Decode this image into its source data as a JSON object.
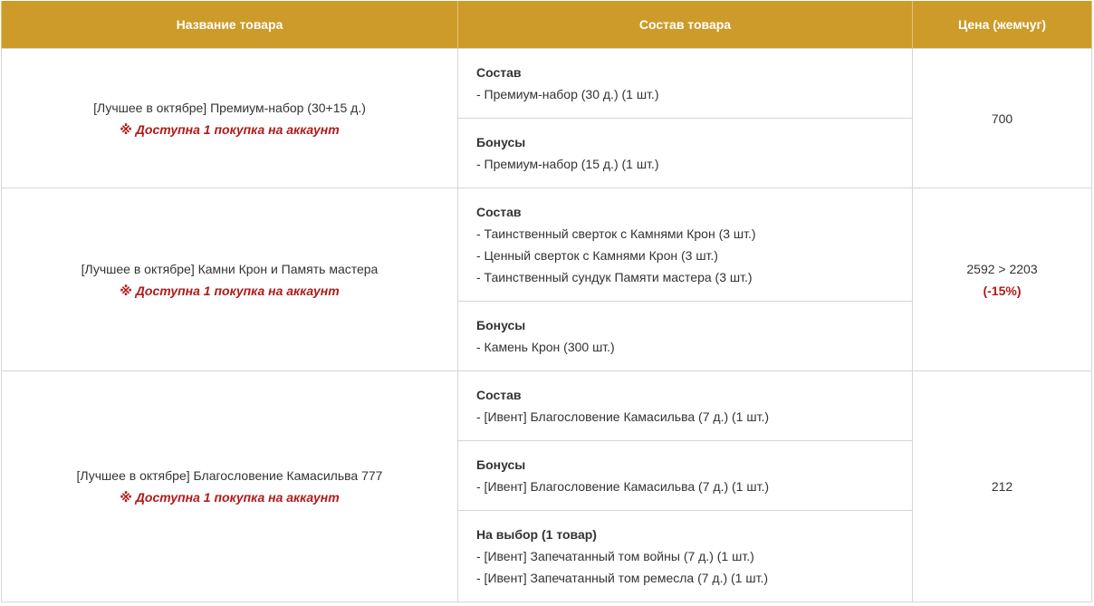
{
  "table": {
    "headers": {
      "name": "Название товара",
      "content": "Состав товара",
      "price": "Цена (жемчуг)"
    },
    "rows": [
      {
        "name": "[Лучшее в октябре] Премиум-набор (30+15 д.)",
        "limit": "※ Доступна 1 покупка на аккаунт",
        "price": "700",
        "discount": "",
        "sections": [
          {
            "title": "Состав",
            "items": [
              "- Премиум-набор (30 д.) (1 шт.)"
            ]
          },
          {
            "title": "Бонусы",
            "items": [
              "- Премиум-набор (15 д.) (1 шт.)"
            ]
          }
        ]
      },
      {
        "name": "[Лучшее в октябре] Камни Крон и Память мастера",
        "limit": "※ Доступна 1 покупка на аккаунт",
        "price": "2592 > 2203",
        "discount": "(-15%)",
        "sections": [
          {
            "title": "Состав",
            "items": [
              "- Таинственный сверток с Камнями Крон (3 шт.)",
              "- Ценный сверток с Камнями Крон (3 шт.)",
              "- Таинственный сундук Памяти мастера (3 шт.)"
            ]
          },
          {
            "title": "Бонусы",
            "items": [
              "- Камень Крон (300 шт.)"
            ]
          }
        ]
      },
      {
        "name": "[Лучшее в октябре] Благословение Камасильва 777",
        "limit": "※ Доступна 1 покупка на аккаунт",
        "price": "212",
        "discount": "",
        "sections": [
          {
            "title": "Состав",
            "items": [
              "- [Ивент] Благословение Камасильва (7 д.) (1 шт.)"
            ]
          },
          {
            "title": "Бонусы",
            "items": [
              "- [Ивент] Благословение Камасильва (7 д.) (1 шт.)"
            ]
          },
          {
            "title": "На выбор (1 товар)",
            "items": [
              "- [Ивент] Запечатанный том войны (7 д.) (1 шт.)",
              "- [Ивент] Запечатанный том ремесла (7 д.) (1 шт.)"
            ]
          }
        ]
      }
    ]
  }
}
